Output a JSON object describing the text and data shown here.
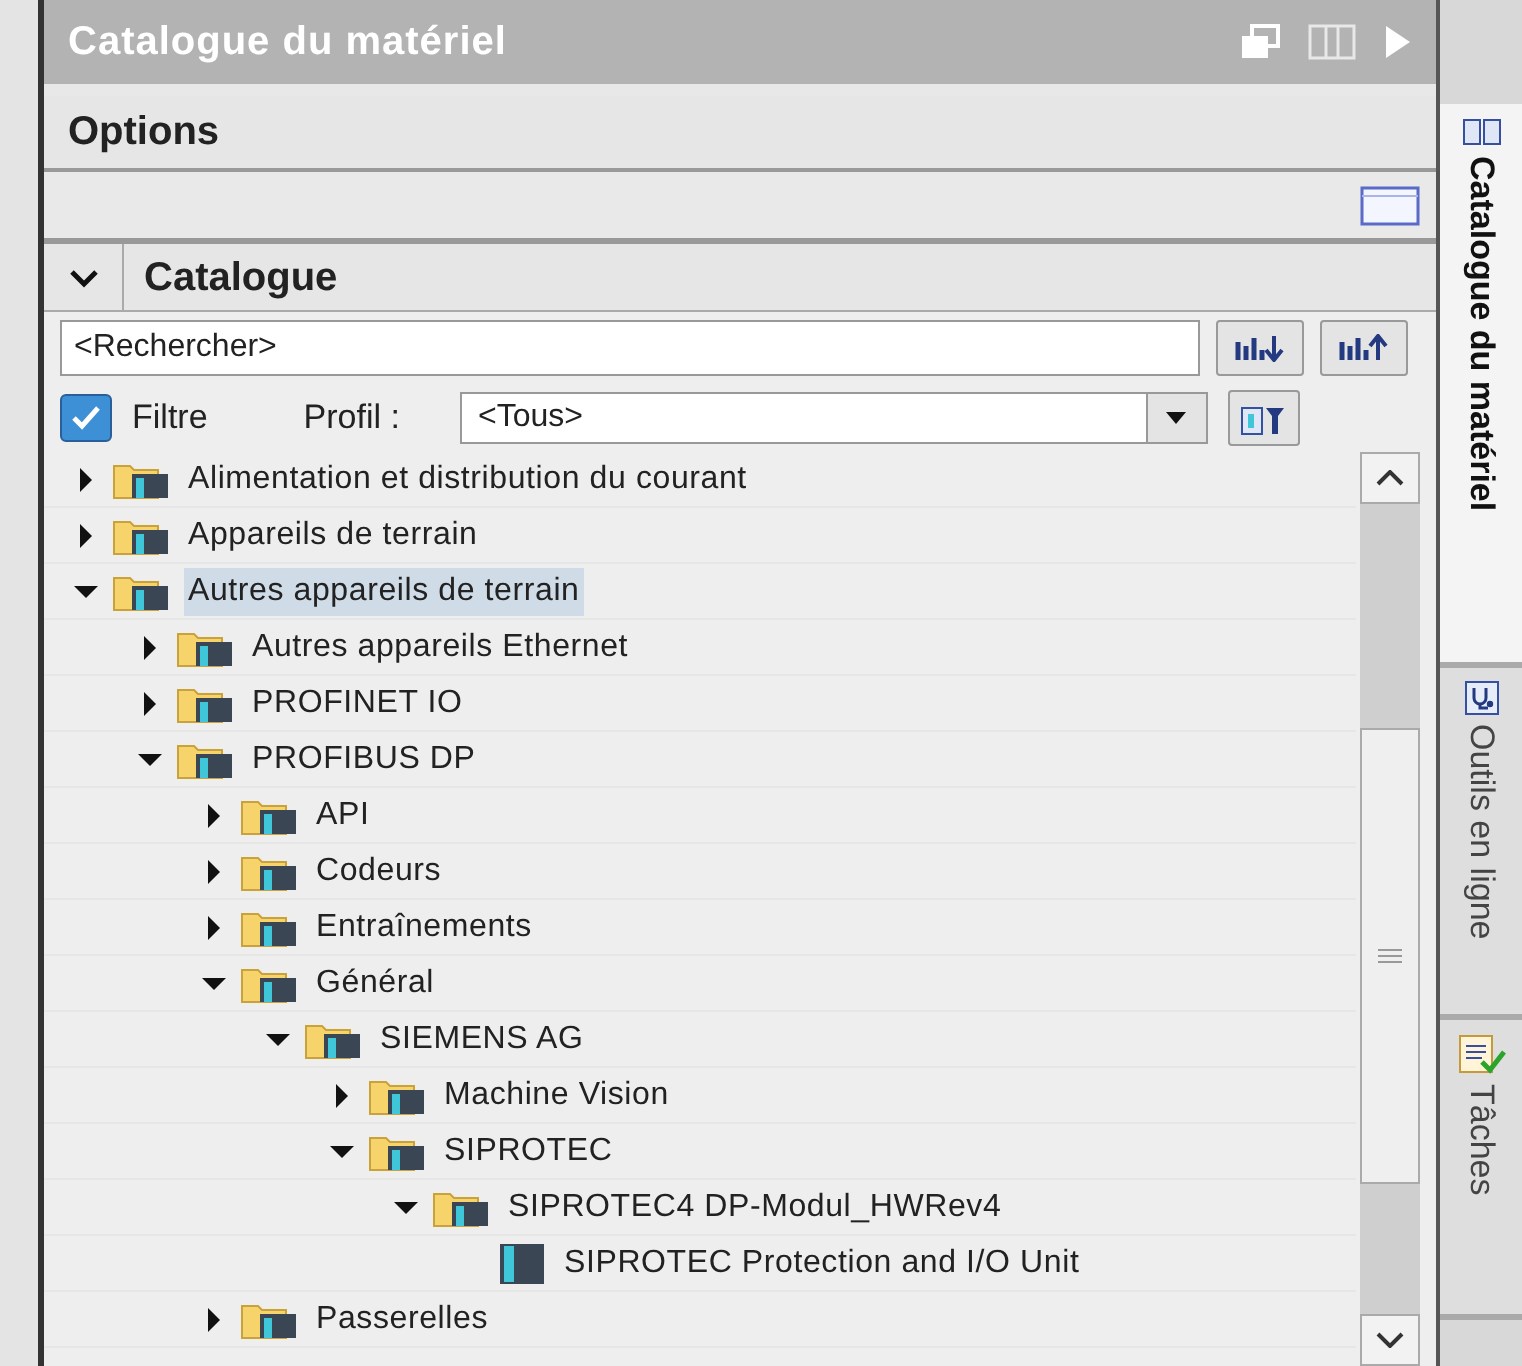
{
  "panel": {
    "title": "Catalogue du matériel"
  },
  "options": {
    "label": "Options"
  },
  "catalogue": {
    "label": "Catalogue",
    "expanded": true
  },
  "search": {
    "placeholder": "<Rechercher>"
  },
  "filter": {
    "label": "Filtre",
    "checked": true
  },
  "profile": {
    "label": "Profil :",
    "value": "<Tous>"
  },
  "tree": [
    {
      "label": "Alimentation et distribution du courant",
      "kind": "folder",
      "expanded": false,
      "selected": false
    },
    {
      "label": "Appareils de terrain",
      "kind": "folder",
      "expanded": false,
      "selected": false
    },
    {
      "label": "Autres appareils de terrain",
      "kind": "folder",
      "expanded": true,
      "selected": true,
      "children": [
        {
          "label": "Autres appareils Ethernet",
          "kind": "folder",
          "expanded": false,
          "selected": false
        },
        {
          "label": "PROFINET IO",
          "kind": "folder",
          "expanded": false,
          "selected": false
        },
        {
          "label": "PROFIBUS DP",
          "kind": "folder",
          "expanded": true,
          "selected": false,
          "children": [
            {
              "label": "API",
              "kind": "folder",
              "expanded": false,
              "selected": false
            },
            {
              "label": "Codeurs",
              "kind": "folder",
              "expanded": false,
              "selected": false
            },
            {
              "label": "Entraînements",
              "kind": "folder",
              "expanded": false,
              "selected": false
            },
            {
              "label": "Général",
              "kind": "folder",
              "expanded": true,
              "selected": false,
              "children": [
                {
                  "label": "SIEMENS AG",
                  "kind": "folder",
                  "expanded": true,
                  "selected": false,
                  "children": [
                    {
                      "label": "Machine Vision",
                      "kind": "folder",
                      "expanded": false,
                      "selected": false
                    },
                    {
                      "label": "SIPROTEC",
                      "kind": "folder",
                      "expanded": true,
                      "selected": false,
                      "children": [
                        {
                          "label": "SIPROTEC4 DP-Modul_HWRev4",
                          "kind": "folder",
                          "expanded": true,
                          "selected": false,
                          "children": [
                            {
                              "label": "SIPROTEC Protection and I/O Unit",
                              "kind": "device",
                              "selected": false
                            }
                          ]
                        }
                      ]
                    }
                  ]
                }
              ]
            },
            {
              "label": "Passerelles",
              "kind": "folder",
              "expanded": false,
              "selected": false
            }
          ]
        }
      ]
    }
  ],
  "side_tabs": [
    {
      "label": "Catalogue du matériel",
      "kind": "catalog",
      "selected": true
    },
    {
      "label": "Outils en ligne",
      "kind": "online",
      "selected": false
    },
    {
      "label": "Tâches",
      "kind": "tasks",
      "selected": false
    }
  ]
}
